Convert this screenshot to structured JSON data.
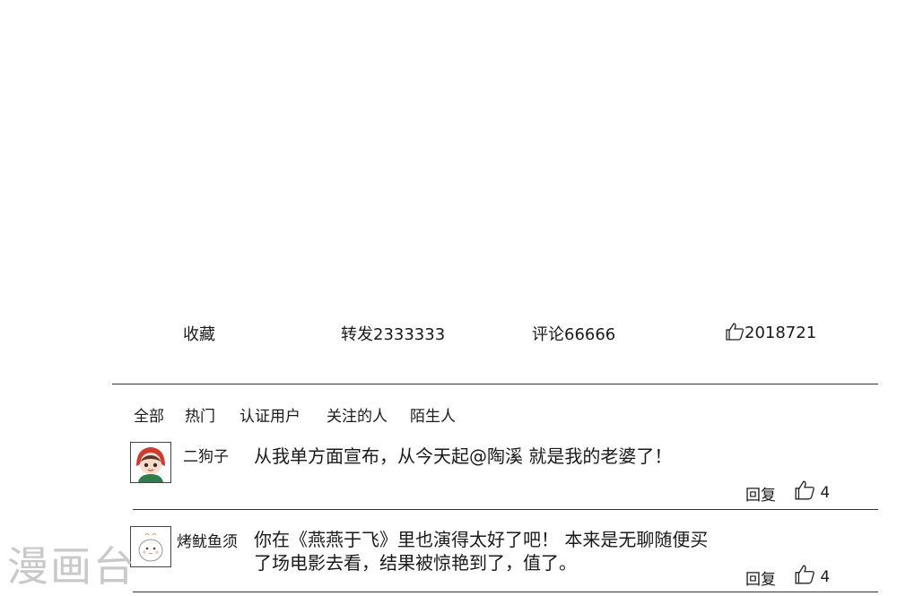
{
  "actions": {
    "favorite": "收藏",
    "repost": "转发2333333",
    "comments": "评论66666",
    "likes": "2018721"
  },
  "filters": [
    "全部",
    "热门",
    "认证用户",
    "关注的人",
    "陌生人"
  ],
  "comments": [
    {
      "user": "二狗子",
      "text": "从我单方面宣布，从今天起@陶溪 就是我的老婆了！",
      "reply": "回复",
      "likes": "4"
    },
    {
      "user": "烤鱿鱼须",
      "text_line1": "你在《燕燕于飞》里也演得太好了吧！ 本来是无聊随便买",
      "text_line2": "了场电影去看，结果被惊艳到了，值了。",
      "reply": "回复",
      "likes": "4"
    }
  ],
  "watermark": "漫画台"
}
